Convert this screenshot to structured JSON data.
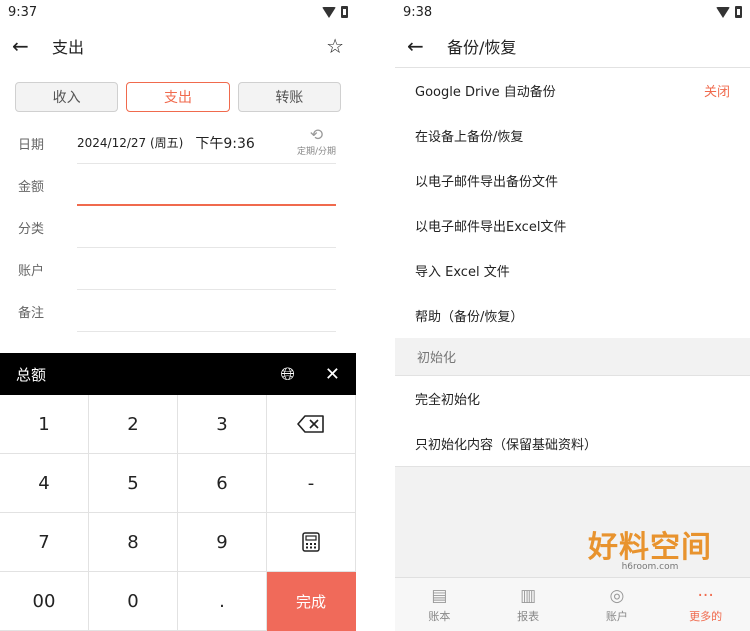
{
  "left": {
    "status": {
      "time": "9:37"
    },
    "appbar": {
      "title": "支出"
    },
    "tabs": [
      {
        "label": "收入",
        "active": false
      },
      {
        "label": "支出",
        "active": true
      },
      {
        "label": "转账",
        "active": false
      }
    ],
    "form": {
      "date_label": "日期",
      "date_value": "2024/12/27 (周五)",
      "time_value": "下午9:36",
      "repeat_label": "定期/分期",
      "amount_label": "金额",
      "category_label": "分类",
      "account_label": "账户",
      "note_label": "备注"
    },
    "keypad": {
      "title": "总额",
      "keys": [
        "1",
        "2",
        "3",
        "",
        "4",
        "5",
        "6",
        "-",
        "7",
        "8",
        "9",
        "",
        "00",
        "0",
        ".",
        "完成"
      ]
    }
  },
  "right": {
    "status": {
      "time": "9:38"
    },
    "appbar": {
      "title": "备份/恢复"
    },
    "backup_items": [
      {
        "label": "Google Drive 自动备份",
        "value": "关闭"
      },
      {
        "label": "在设备上备份/恢复"
      },
      {
        "label": "以电子邮件导出备份文件"
      },
      {
        "label": "以电子邮件导出Excel文件"
      },
      {
        "label": "导入 Excel 文件"
      },
      {
        "label": "帮助（备份/恢复）"
      }
    ],
    "init_section": "初始化",
    "init_items": [
      {
        "label": "完全初始化"
      },
      {
        "label": "只初始化内容（保留基础资料）"
      }
    ],
    "watermark": {
      "big": "好料空间",
      "small": "h6room.com"
    },
    "bottom_nav": [
      {
        "label": "账本",
        "icon": "book-icon",
        "active": false
      },
      {
        "label": "报表",
        "icon": "chart-icon",
        "active": false
      },
      {
        "label": "账户",
        "icon": "coins-icon",
        "active": false
      },
      {
        "label": "更多的",
        "icon": "more-icon",
        "active": true
      }
    ]
  },
  "colors": {
    "accent": "#f06a4d",
    "done_key": "#f06a5a",
    "keypad_header": "#000000"
  }
}
